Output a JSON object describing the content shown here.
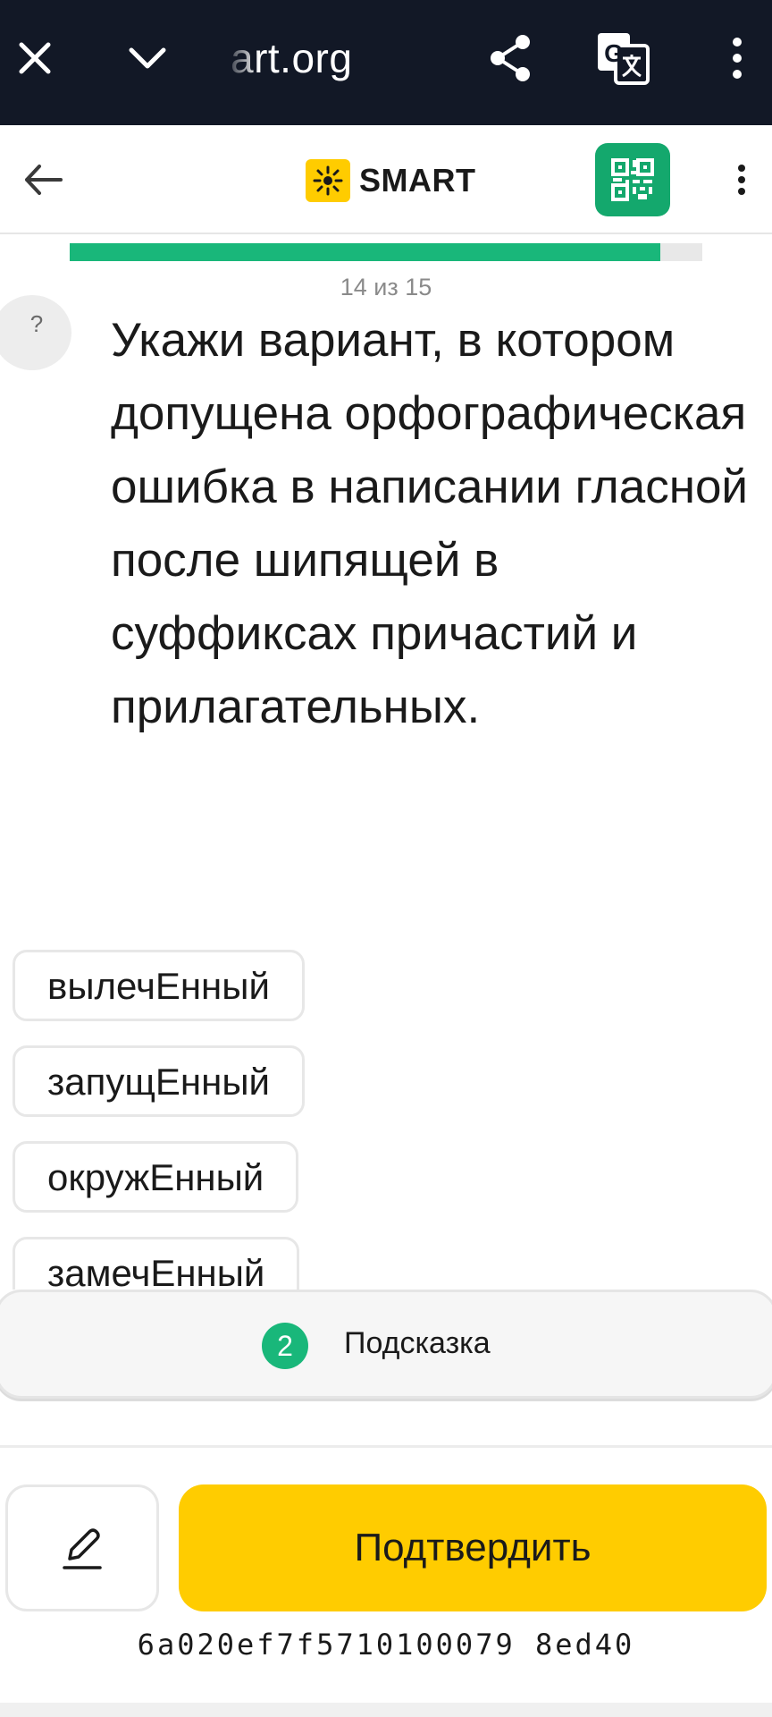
{
  "browser": {
    "url_partial": "art.org",
    "icons": [
      "close-icon",
      "chevron-down-icon",
      "share-icon",
      "translate-icon",
      "more-vertical-icon"
    ]
  },
  "header": {
    "logo_text": "SMART",
    "icons": [
      "arrow-left-icon",
      "sun-icon",
      "qr-code-icon",
      "more-vertical-icon"
    ],
    "colors": {
      "qr_button": "#14a86d",
      "logo_square": "#ffcc00"
    }
  },
  "progress": {
    "current": 14,
    "total": 15,
    "label": "14 из 15",
    "color": "#19b77a"
  },
  "question": {
    "badge": "?",
    "text": "Укажи вариант, в котором допущена орфографическая ошибка в написании гласной после шипящей в суффиксах причастий и прилагательных."
  },
  "options": [
    {
      "label": "вылечЕнный"
    },
    {
      "label": "запущЕнный"
    },
    {
      "label": "окружЕнный"
    },
    {
      "label": "замечЕнный"
    }
  ],
  "hint": {
    "count": "2",
    "label": "Подсказка"
  },
  "actions": {
    "edit_icon": "pencil-icon",
    "confirm_label": "Подтвердить",
    "confirm_color": "#ffcc00"
  },
  "footer": {
    "code": "6a020ef7f5710100079 8ed40"
  }
}
